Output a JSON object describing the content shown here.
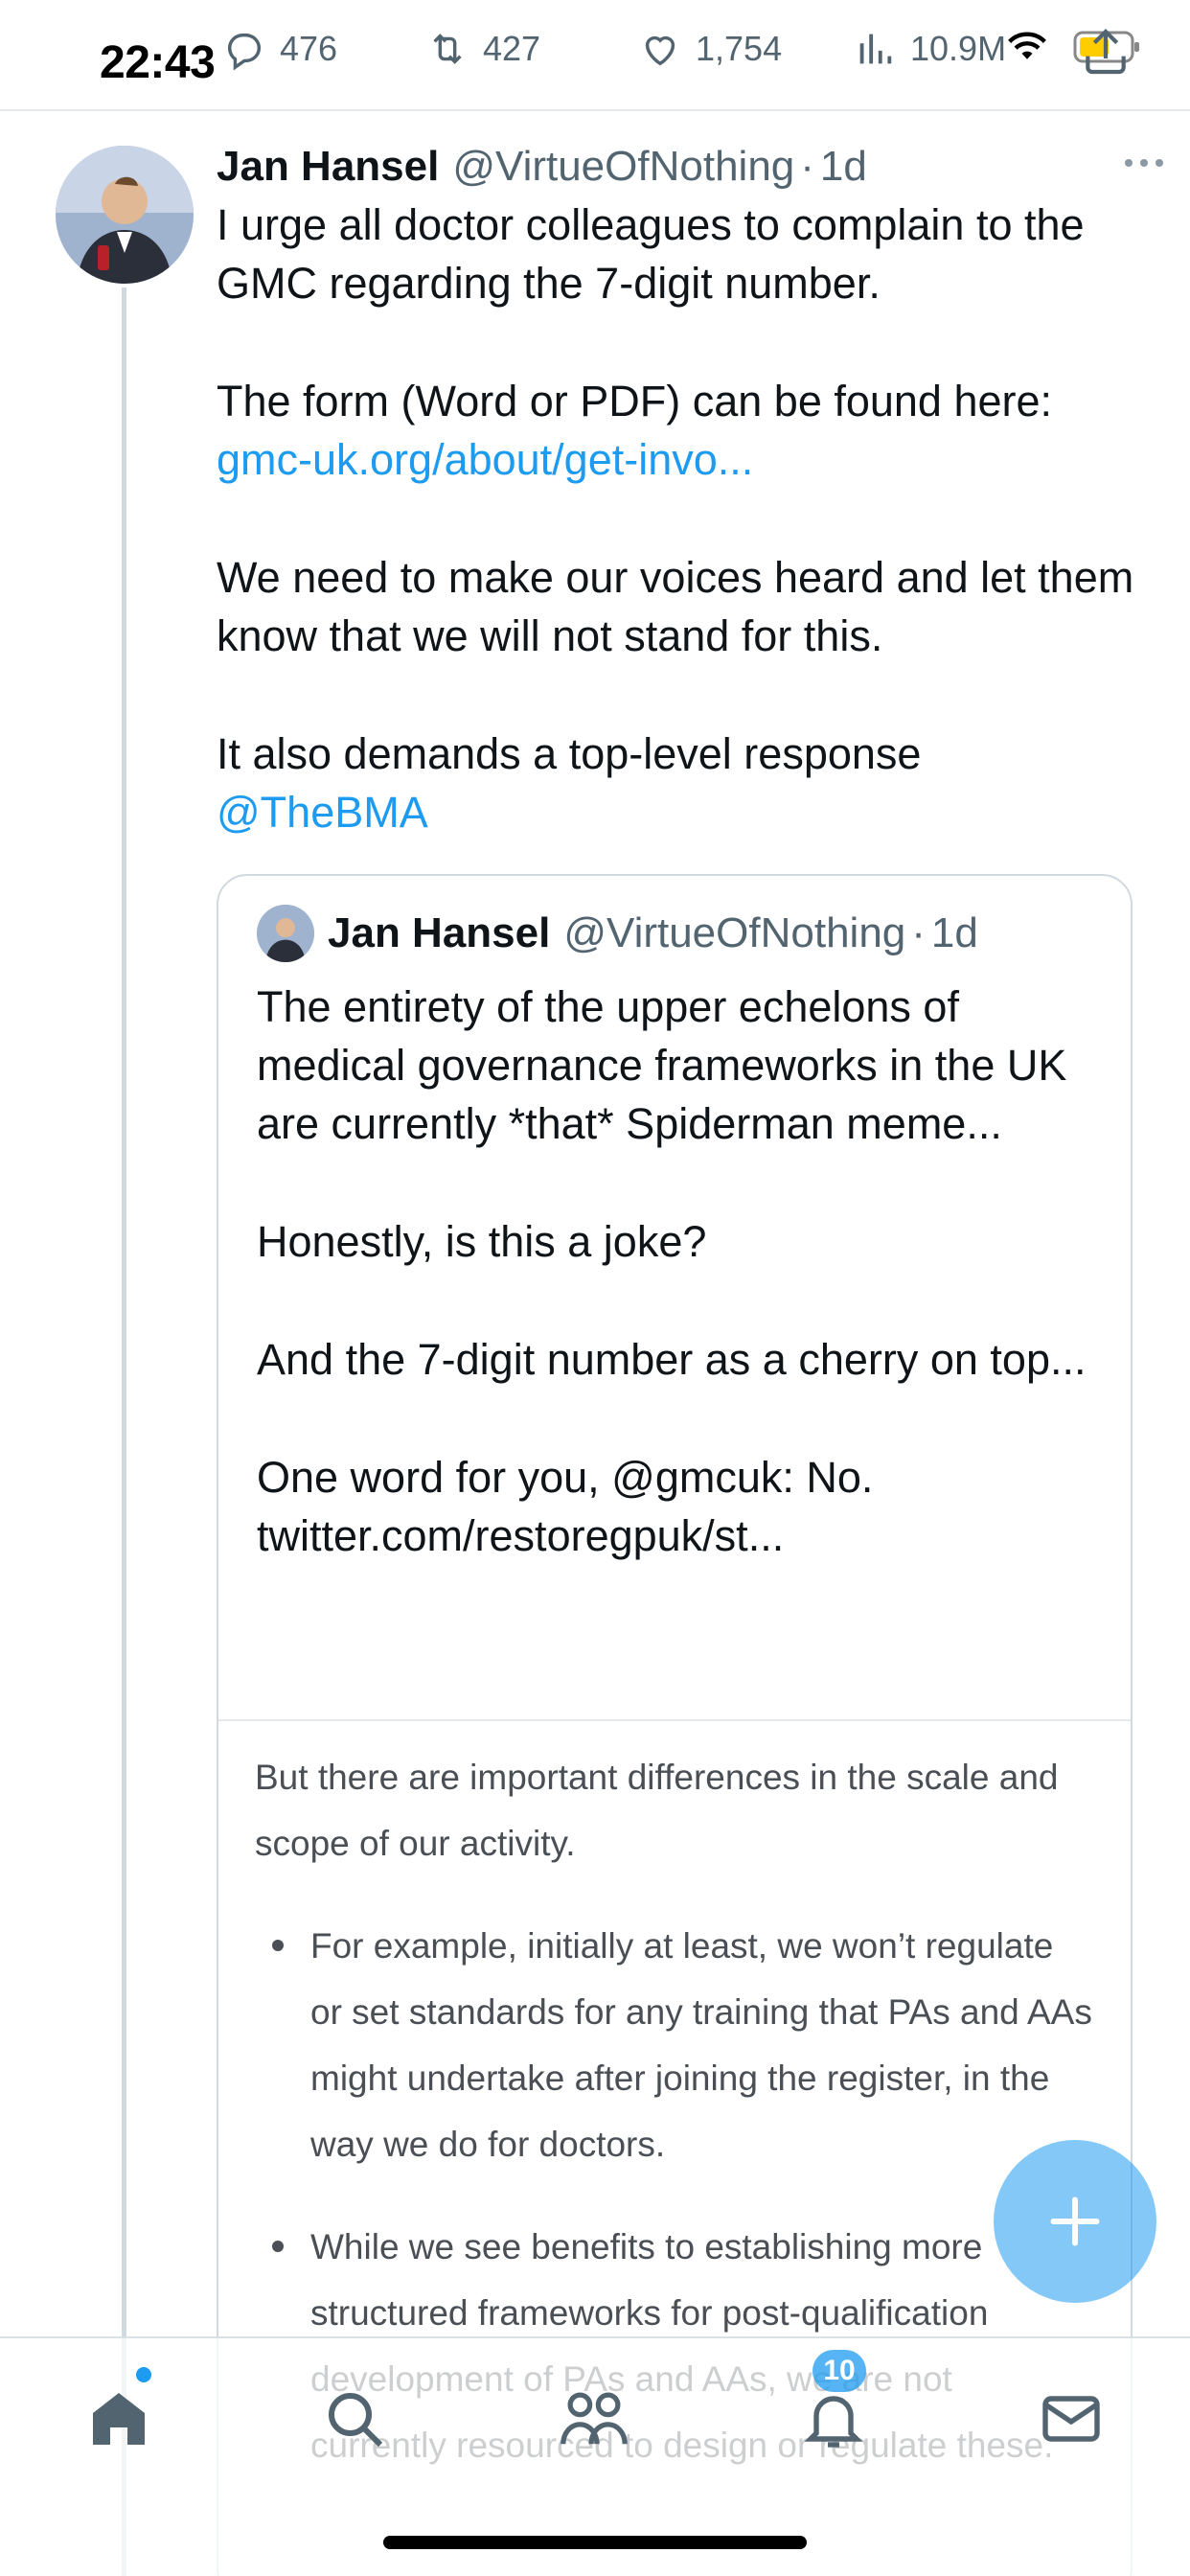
{
  "status_bar": {
    "time": "22:43",
    "replies": "476",
    "reposts": "427",
    "likes": "1,754",
    "views": "10.9M"
  },
  "tweet": {
    "author_name": "Jan Hansel",
    "author_handle": "@VirtueOfNothing",
    "separator": "·",
    "age": "1d",
    "line1": "I urge all doctor colleagues to complain to the GMC regarding the 7-digit number.",
    "line2": "The form (Word or PDF) can be found here:",
    "link": "gmc-uk.org/about/get-invo...",
    "line3": "We need to make our voices heard and let them know that we will not stand for this.",
    "line4": "It also demands a top-level response",
    "mention": "@TheBMA"
  },
  "quote": {
    "author_name": "Jan Hansel",
    "author_handle": "@VirtueOfNothing",
    "separator": "·",
    "age": "1d",
    "para1": "The entirety of the upper echelons of medical governance frameworks in the UK are currently *that* Spiderman meme...",
    "para2": "Honestly, is this a joke?",
    "para3": "And the 7-digit number as a cherry on top...",
    "para4": "One word for you, @gmcuk: No.",
    "para5": "twitter.com/restoregpuk/st...",
    "media": {
      "intro": "But there are important differences in the scale and scope of our activity.",
      "bullet1": "For example, initially at least, we won’t regulate or set standards for any training that PAs and AAs might undertake after joining the register, in the way we do for doctors.",
      "bullet2": "While we see benefits to establishing more structured frameworks for post-qualification development of PAs and AAs, we are not currently resourced to design or regulate these."
    }
  },
  "bottom_nav": {
    "notifications_badge": "10"
  },
  "colors": {
    "accent": "#1d9bf0",
    "secondary_text": "#536471",
    "border": "#cfd9de"
  },
  "icons": [
    "reply-icon",
    "repost-icon",
    "like-icon",
    "views-icon",
    "wifi-icon",
    "battery-icon",
    "share-icon",
    "more-icon",
    "compose-icon",
    "home-icon",
    "search-icon",
    "communities-icon",
    "notifications-icon",
    "messages-icon"
  ]
}
